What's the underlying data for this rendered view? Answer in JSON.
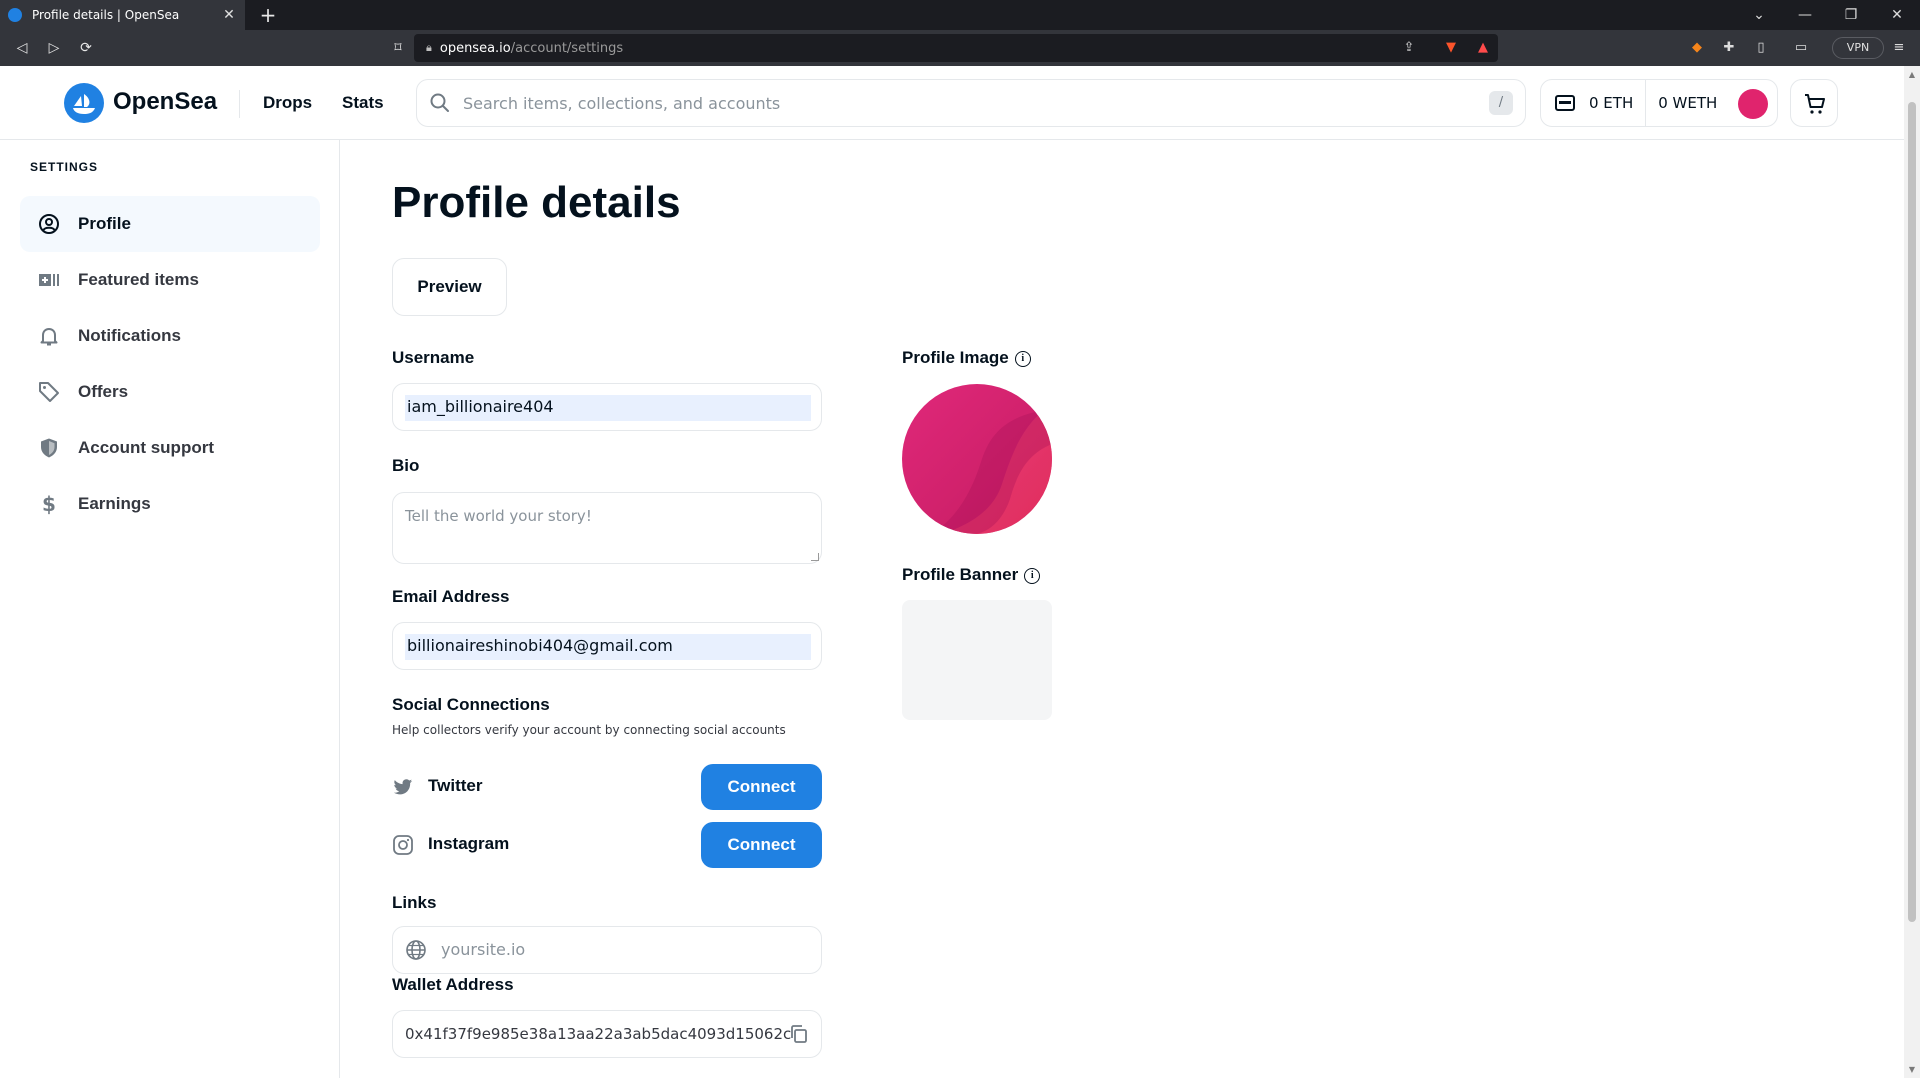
{
  "browser": {
    "tab_title": "Profile details | OpenSea",
    "new_tab": "+",
    "url_host": "opensea.io",
    "url_path": "/account/settings",
    "vpn_label": "VPN",
    "window_controls": [
      "⌄",
      "—",
      "❐",
      "✕"
    ]
  },
  "header": {
    "logo_text": "OpenSea",
    "nav": [
      "Drops",
      "Stats"
    ],
    "search_placeholder": "Search items, collections, and accounts",
    "search_shortcut": "/",
    "eth_balance": "0 ETH",
    "weth_balance": "0 WETH",
    "avatar_color": "#e0246d"
  },
  "sidebar": {
    "heading": "SETTINGS",
    "items": [
      {
        "label": "Profile",
        "icon": "user-circle-icon",
        "active": true
      },
      {
        "label": "Featured items",
        "icon": "featured-grid-icon",
        "active": false
      },
      {
        "label": "Notifications",
        "icon": "bell-icon",
        "active": false
      },
      {
        "label": "Offers",
        "icon": "tag-icon",
        "active": false
      },
      {
        "label": "Account support",
        "icon": "shield-icon",
        "active": false
      },
      {
        "label": "Earnings",
        "icon": "dollar-icon",
        "active": false
      }
    ]
  },
  "main": {
    "title": "Profile details",
    "preview_label": "Preview",
    "username_label": "Username",
    "username_value": "iam_billionaire404",
    "bio_label": "Bio",
    "bio_placeholder": "Tell the world your story!",
    "email_label": "Email Address",
    "email_value": "billionaireshinobi404@gmail.com",
    "social_label": "Social Connections",
    "social_help": "Help collectors verify your account by connecting social accounts",
    "social": [
      {
        "name": "Twitter",
        "icon": "twitter-icon",
        "button": "Connect"
      },
      {
        "name": "Instagram",
        "icon": "instagram-icon",
        "button": "Connect"
      }
    ],
    "links_label": "Links",
    "links_placeholder": "yoursite.io",
    "wallet_label": "Wallet Address",
    "wallet_value": "0x41f37f9e985e38a13aa22a3ab5dac4093d15062c",
    "profile_image_label": "Profile Image",
    "profile_banner_label": "Profile Banner"
  },
  "colors": {
    "accent": "#2081e2",
    "text": "#04111d",
    "border": "#e5e8eb"
  }
}
